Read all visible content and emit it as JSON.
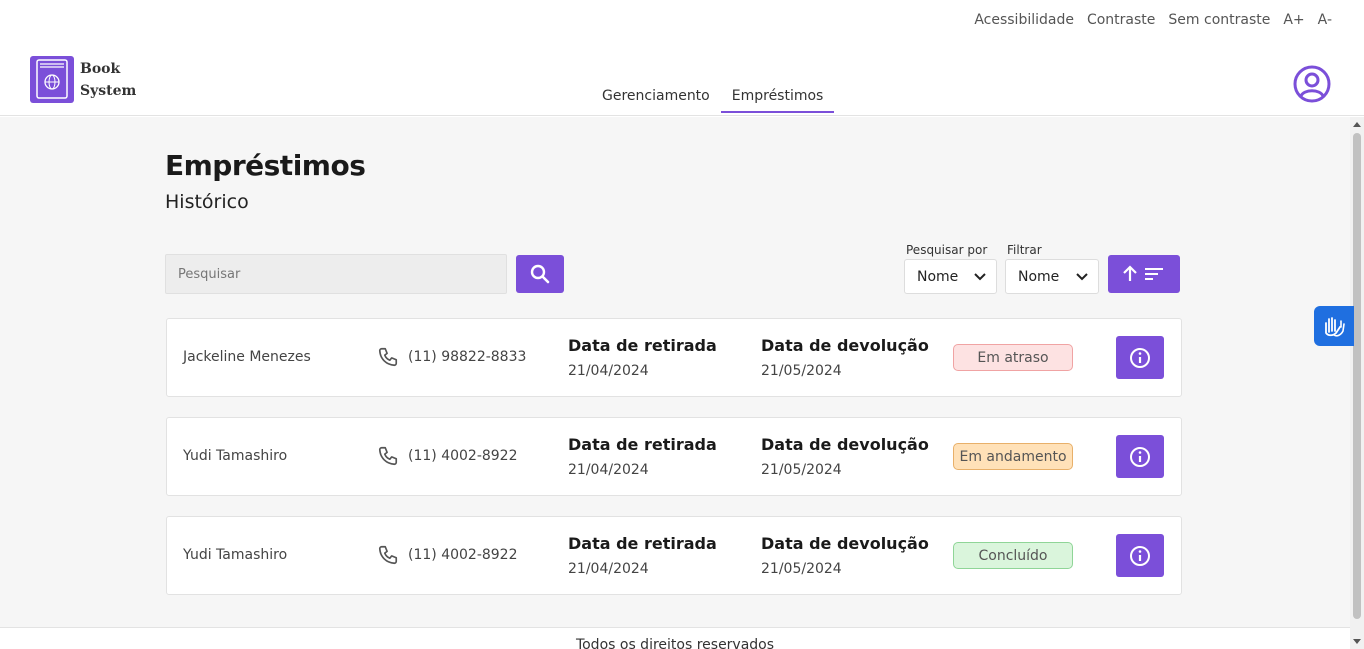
{
  "accessibility": {
    "items": [
      "Acessibilidade",
      "Contraste",
      "Sem contraste",
      "A+",
      "A-"
    ]
  },
  "header": {
    "logo_line1": "Book",
    "logo_line2": "System",
    "nav": [
      {
        "label": "Gerenciamento",
        "active": false
      },
      {
        "label": "Empréstimos",
        "active": true
      }
    ]
  },
  "page": {
    "title": "Empréstimos",
    "subtitle": "Histórico"
  },
  "search": {
    "placeholder": "Pesquisar",
    "search_by_label": "Pesquisar por",
    "search_by_value": "Nome",
    "filter_label": "Filtrar",
    "filter_value": "Nome"
  },
  "loans": [
    {
      "name": "Jackeline Menezes",
      "phone": "(11) 98822-8833",
      "pickup_label": "Data de retirada",
      "pickup_date": "21/04/2024",
      "return_label": "Data de devolução",
      "return_date": "21/05/2024",
      "status": "Em atraso",
      "status_color": "#fde2e2",
      "status_border": "#f0a3a3"
    },
    {
      "name": "Yudi Tamashiro",
      "phone": "(11) 4002-8922",
      "pickup_label": "Data de retirada",
      "pickup_date": "21/04/2024",
      "return_label": "Data de devolução",
      "return_date": "21/05/2024",
      "status": "Em andamento",
      "status_color": "#ffe1b8",
      "status_border": "#e8b06a"
    },
    {
      "name": "Yudi Tamashiro",
      "phone": "(11) 4002-8922",
      "pickup_label": "Data de retirada",
      "pickup_date": "21/04/2024",
      "return_label": "Data de devolução",
      "return_date": "21/05/2024",
      "status": "Concluído",
      "status_color": "#daf5dc",
      "status_border": "#8fd597"
    }
  ],
  "footer": {
    "text": "Todos os direitos reservados"
  },
  "colors": {
    "accent": "#7b4fd9"
  }
}
